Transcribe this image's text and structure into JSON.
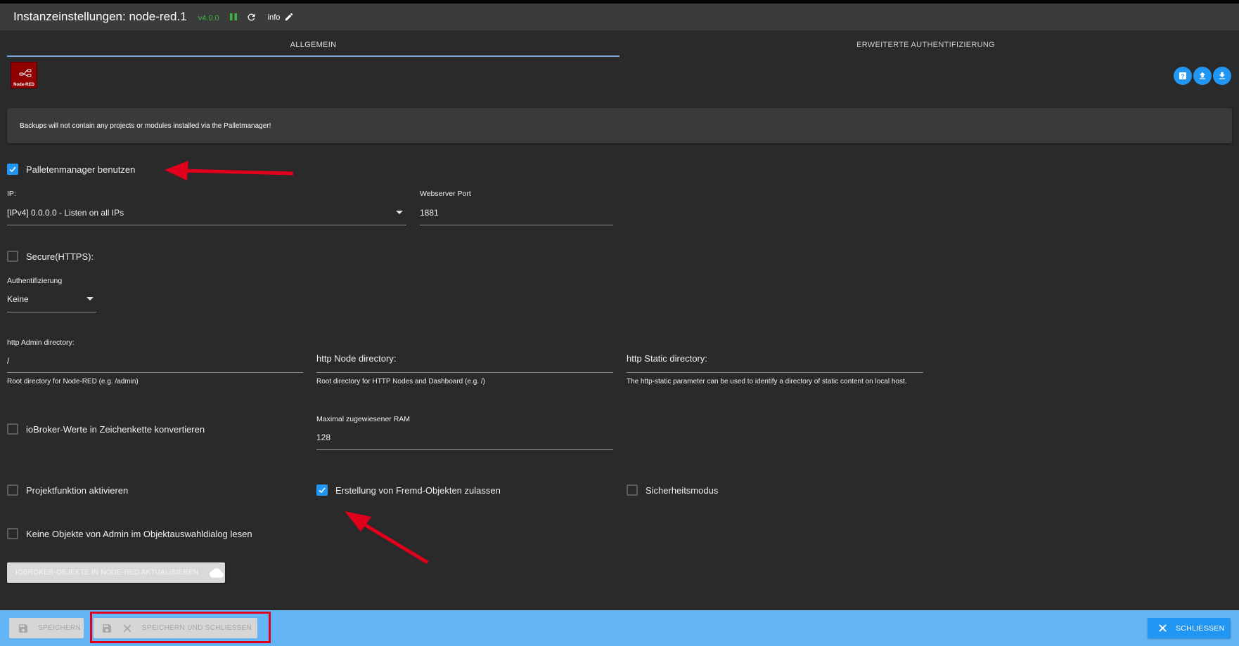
{
  "header": {
    "title": "Instanzeinstellungen: node-red.1",
    "version": "v4.0.0",
    "info_label": "info"
  },
  "tabs": [
    {
      "label": "ALLGEMEIN",
      "active": true
    },
    {
      "label": "ERWEITERTE AUTHENTIFIZIERUNG",
      "active": false
    }
  ],
  "logo": {
    "text": "Node-RED"
  },
  "notice": "Backups will not contain any projects or modules installed via the Palletmanager!",
  "form": {
    "palette_manager": {
      "label": "Palletenmanager benutzen",
      "checked": true
    },
    "ip": {
      "label": "IP:",
      "value": "[IPv4] 0.0.0.0 - Listen on all IPs"
    },
    "webserver_port": {
      "label": "Webserver Port",
      "value": "1881"
    },
    "secure": {
      "label": "Secure(HTTPS):",
      "checked": false
    },
    "auth": {
      "label": "Authentifizierung",
      "value": "Keine"
    },
    "http_admin": {
      "label": "http Admin directory:",
      "value": "/",
      "helper": "Root directory for Node-RED (e.g. /admin)"
    },
    "http_node": {
      "label": "http Node directory:",
      "value": "",
      "helper": "Root directory for HTTP Nodes and Dashboard (e.g. /)"
    },
    "http_static": {
      "label": "http Static directory:",
      "value": "",
      "helper": "The http-static parameter can be used to identify a directory of static content on local host."
    },
    "convert_values": {
      "label": "ioBroker-Werte in Zeichenkette konvertieren",
      "checked": false
    },
    "max_ram": {
      "label": "Maximal zugewiesener RAM",
      "value": "128"
    },
    "project_func": {
      "label": "Projektfunktion aktivieren",
      "checked": false
    },
    "foreign_objects": {
      "label": "Erstellung von Fremd-Objekten zulassen",
      "checked": true
    },
    "safe_mode": {
      "label": "Sicherheitsmodus",
      "checked": false
    },
    "no_admin_objects": {
      "label": "Keine Objekte von Admin im Objektauswahldialog lesen",
      "checked": false
    },
    "update_button": "IOBROKER-OBJEKTE IN NODE-RED AKTUALISIEREN"
  },
  "footer": {
    "save": "SPEICHERN",
    "save_close": "SPEICHERN UND SCHLIESSEN",
    "close": "SCHLIESSEN"
  },
  "colors": {
    "accent": "#2196f3",
    "footer_bg": "#64b5f6",
    "annotation": "#e0001b",
    "version": "#3fb33f"
  }
}
